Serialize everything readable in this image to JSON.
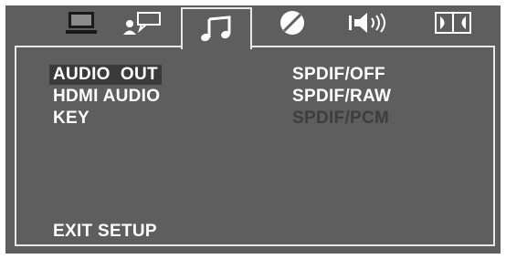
{
  "tabs": [
    {
      "icon": "monitor-icon",
      "active": false
    },
    {
      "icon": "person-speech-icon",
      "active": false
    },
    {
      "icon": "music-note-icon",
      "active": true
    },
    {
      "icon": "circle-slash-icon",
      "active": false
    },
    {
      "icon": "speaker-volume-icon",
      "active": false
    },
    {
      "icon": "dolby-icon",
      "active": false
    }
  ],
  "menu": {
    "items": [
      {
        "label": "AUDIO  OUT",
        "selected": true
      },
      {
        "label": "HDMI AUDIO",
        "selected": false
      },
      {
        "label": "KEY",
        "selected": false
      }
    ],
    "exit_label": "EXIT SETUP"
  },
  "options": [
    {
      "label": "SPDIF/OFF",
      "enabled": true
    },
    {
      "label": "SPDIF/RAW",
      "enabled": true
    },
    {
      "label": "SPDIF/PCM",
      "enabled": false
    }
  ],
  "colors": {
    "background": "#5e5e5e",
    "text": "#ffffff",
    "disabled_text": "#3d3d3d",
    "border": "#e8e8e8"
  }
}
